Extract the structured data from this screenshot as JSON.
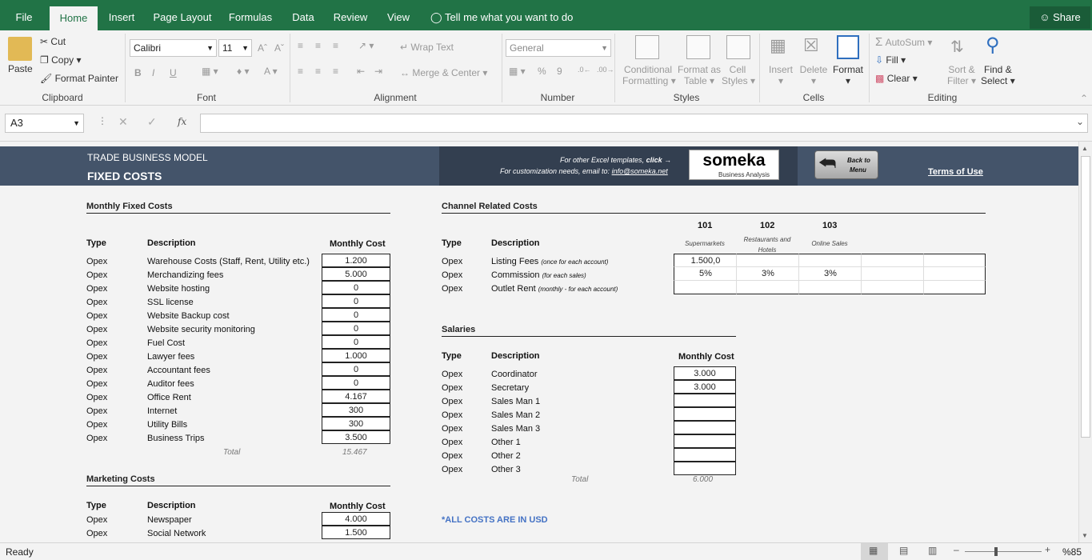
{
  "tabs": [
    "File",
    "Home",
    "Insert",
    "Page Layout",
    "Formulas",
    "Data",
    "Review",
    "View"
  ],
  "tell_me": "Tell me what you want to do",
  "share": "Share",
  "clipboard": {
    "paste": "Paste",
    "cut": "Cut",
    "copy": "Copy",
    "format_painter": "Format Painter",
    "label": "Clipboard"
  },
  "font": {
    "name": "Calibri",
    "size": "11",
    "bold": "B",
    "italic": "I",
    "underline": "U",
    "label": "Font"
  },
  "alignment": {
    "wrap": "Wrap Text",
    "merge": "Merge & Center",
    "label": "Alignment"
  },
  "number": {
    "format": "General",
    "percent": "%",
    "comma": "9",
    "label": "Number"
  },
  "styles": {
    "conditional": "Conditional",
    "formatting": "Formatting",
    "format_as": "Format as",
    "table": "Table",
    "cell": "Cell",
    "cell_styles": "Styles",
    "label": "Styles"
  },
  "cells": {
    "insert": "Insert",
    "delete": "Delete",
    "format": "Format",
    "label": "Cells"
  },
  "editing": {
    "autosum": "AutoSum",
    "fill": "Fill",
    "clear": "Clear",
    "sort": "Sort &",
    "filter": "Filter",
    "find": "Find &",
    "select": "Select",
    "label": "Editing"
  },
  "namebox": "A3",
  "fx": "fx",
  "sheet": {
    "header_title": "TRADE BUSINESS MODEL",
    "header_sub": "FIXED COSTS",
    "promo1": "For other Excel templates,",
    "promo1_click": "click",
    "promo2": "For customization needs, email to:",
    "promo_email": "info@someka.net",
    "logo": "someka",
    "logo_sub": "Business Analysis",
    "back1": "Back to",
    "back2": "Menu",
    "terms": "Terms of Use",
    "monthly": {
      "title": "Monthly Fixed Costs",
      "col_type": "Type",
      "col_desc": "Description",
      "col_cost": "Monthly Cost",
      "rows": [
        {
          "type": "Opex",
          "desc": "Warehouse Costs (Staff, Rent, Utility etc.)",
          "cost": "1.200"
        },
        {
          "type": "Opex",
          "desc": "Merchandizing fees",
          "cost": "5.000"
        },
        {
          "type": "Opex",
          "desc": "Website hosting",
          "cost": "0"
        },
        {
          "type": "Opex",
          "desc": "SSL license",
          "cost": "0"
        },
        {
          "type": "Opex",
          "desc": "Website Backup cost",
          "cost": "0"
        },
        {
          "type": "Opex",
          "desc": "Website security monitoring",
          "cost": "0"
        },
        {
          "type": "Opex",
          "desc": "Fuel Cost",
          "cost": "0"
        },
        {
          "type": "Opex",
          "desc": "Lawyer fees",
          "cost": "1.000"
        },
        {
          "type": "Opex",
          "desc": "Accountant fees",
          "cost": "0"
        },
        {
          "type": "Opex",
          "desc": "Auditor fees",
          "cost": "0"
        },
        {
          "type": "Opex",
          "desc": "Office Rent",
          "cost": "4.167"
        },
        {
          "type": "Opex",
          "desc": "Internet",
          "cost": "300"
        },
        {
          "type": "Opex",
          "desc": "Utility Bills",
          "cost": "300"
        },
        {
          "type": "Opex",
          "desc": "Business Trips",
          "cost": "3.500"
        }
      ],
      "total_label": "Total",
      "total": "15.467"
    },
    "marketing": {
      "title": "Marketing Costs",
      "col_type": "Type",
      "col_desc": "Description",
      "col_cost": "Monthly Cost",
      "rows": [
        {
          "type": "Opex",
          "desc": "Newspaper",
          "cost": "4.000"
        },
        {
          "type": "Opex",
          "desc": "Social Network",
          "cost": "1.500"
        }
      ]
    },
    "channel": {
      "title": "Channel Related Costs",
      "col_type": "Type",
      "col_desc": "Description",
      "codes": [
        "101",
        "102",
        "103"
      ],
      "channels": [
        "Supermarkets",
        "Restaurants and Hotels",
        "Online Sales"
      ],
      "rows": [
        {
          "type": "Opex",
          "desc": "Listing Fees",
          "note": "(once for each account)",
          "v": [
            "1.500,0",
            "",
            ""
          ]
        },
        {
          "type": "Opex",
          "desc": "Commission",
          "note": "(for each sales)",
          "v": [
            "5%",
            "3%",
            "3%"
          ]
        },
        {
          "type": "Opex",
          "desc": "Outlet Rent",
          "note": "(monthly - for each account)",
          "v": [
            "",
            "",
            ""
          ]
        }
      ]
    },
    "salaries": {
      "title": "Salaries",
      "col_type": "Type",
      "col_desc": "Description",
      "col_cost": "Monthly Cost",
      "rows": [
        {
          "type": "Opex",
          "desc": "Coordinator",
          "cost": "3.000"
        },
        {
          "type": "Opex",
          "desc": "Secretary",
          "cost": "3.000"
        },
        {
          "type": "Opex",
          "desc": "Sales Man 1",
          "cost": ""
        },
        {
          "type": "Opex",
          "desc": "Sales Man 2",
          "cost": ""
        },
        {
          "type": "Opex",
          "desc": "Sales Man 3",
          "cost": ""
        },
        {
          "type": "Opex",
          "desc": "Other 1",
          "cost": ""
        },
        {
          "type": "Opex",
          "desc": "Other 2",
          "cost": ""
        },
        {
          "type": "Opex",
          "desc": "Other 3",
          "cost": ""
        }
      ],
      "total_label": "Total",
      "total": "6.000"
    },
    "usd_note": "*ALL COSTS ARE IN USD"
  },
  "status": {
    "ready": "Ready",
    "zoom": "%85"
  },
  "colors": {
    "excel_green": "#217346",
    "header_blue": "#44546a",
    "header_dark": "#333f50",
    "note_blue": "#4472c4"
  }
}
